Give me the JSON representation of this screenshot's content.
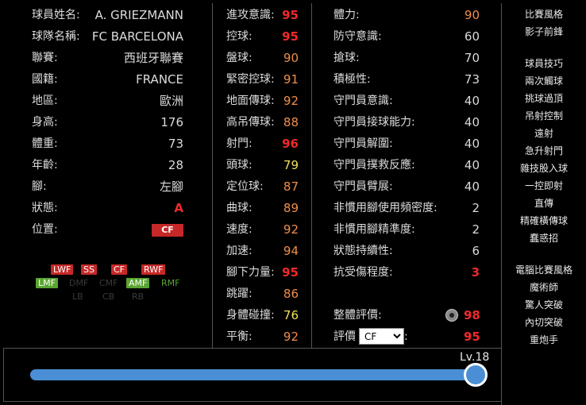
{
  "colors": {
    "red": "#ef2a2a",
    "orange": "#f08e4a",
    "yellow": "#f0e05a",
    "white": "#d9d9d9",
    "tag_red": "#c62828",
    "tag_green": "#5aa532",
    "text_green": "#5aa532"
  },
  "player": {
    "rows": [
      {
        "label": "球員姓名:",
        "value": "A. GRIEZMANN"
      },
      {
        "label": "球隊名稱:",
        "value": "FC BARCELONA"
      },
      {
        "label": "聯賽:",
        "value": "西班牙聯賽"
      },
      {
        "label": "國籍:",
        "value": "FRANCE"
      },
      {
        "label": "地區:",
        "value": "歐洲"
      },
      {
        "label": "身高:",
        "value": "176"
      },
      {
        "label": "體重:",
        "value": "73"
      },
      {
        "label": "年齡:",
        "value": "28"
      },
      {
        "label": "腳:",
        "value": "左腳"
      },
      {
        "label": "狀態:",
        "value": "A"
      },
      {
        "label": "位置:",
        "value": "CF"
      }
    ],
    "positions_row1": [
      "LWF",
      "SS",
      "CF",
      "RWF"
    ],
    "positions_row2": [
      "LMF",
      "DMF",
      "CMF",
      "AMF",
      "RMF"
    ],
    "positions_row3": [
      "LB",
      "CB",
      "RB"
    ]
  },
  "stats_col1": [
    {
      "label": "進攻意識:",
      "value": "95",
      "color": "red"
    },
    {
      "label": "控球:",
      "value": "95",
      "color": "red"
    },
    {
      "label": "盤球:",
      "value": "90",
      "color": "orange"
    },
    {
      "label": "緊密控球:",
      "value": "91",
      "color": "orange"
    },
    {
      "label": "地面傳球:",
      "value": "92",
      "color": "orange"
    },
    {
      "label": "高吊傳球:",
      "value": "88",
      "color": "orange"
    },
    {
      "label": "射門:",
      "value": "96",
      "color": "red"
    },
    {
      "label": "頭球:",
      "value": "79",
      "color": "yellow"
    },
    {
      "label": "定位球:",
      "value": "87",
      "color": "orange"
    },
    {
      "label": "曲球:",
      "value": "89",
      "color": "orange"
    },
    {
      "label": "速度:",
      "value": "92",
      "color": "orange"
    },
    {
      "label": "加速:",
      "value": "94",
      "color": "orange"
    },
    {
      "label": "腳下力量:",
      "value": "95",
      "color": "red"
    },
    {
      "label": "跳躍:",
      "value": "86",
      "color": "orange"
    },
    {
      "label": "身體碰撞:",
      "value": "76",
      "color": "yellow"
    },
    {
      "label": "平衡:",
      "value": "92",
      "color": "orange"
    }
  ],
  "stats_col2": [
    {
      "label": "體力:",
      "value": "90",
      "color": "orange"
    },
    {
      "label": "防守意識:",
      "value": "60",
      "color": "white"
    },
    {
      "label": "搶球:",
      "value": "70",
      "color": "white"
    },
    {
      "label": "積極性:",
      "value": "73",
      "color": "white"
    },
    {
      "label": "守門員意識:",
      "value": "40",
      "color": "white"
    },
    {
      "label": "守門員接球能力:",
      "value": "40",
      "color": "white"
    },
    {
      "label": "守門員解圍:",
      "value": "40",
      "color": "white"
    },
    {
      "label": "守門員撲救反應:",
      "value": "40",
      "color": "white"
    },
    {
      "label": "守門員臂展:",
      "value": "40",
      "color": "white"
    },
    {
      "label": "非慣用腳使用頻密度:",
      "value": "2",
      "color": "white"
    },
    {
      "label": "非慣用腳精準度:",
      "value": "2",
      "color": "white"
    },
    {
      "label": "狀態持續性:",
      "value": "6",
      "color": "white"
    },
    {
      "label": "抗受傷程度:",
      "value": "3",
      "color": "red"
    }
  ],
  "overall": {
    "label": "整體評價:",
    "value": "98"
  },
  "rating": {
    "label": "評價",
    "selected": "CF",
    "value": "95"
  },
  "sidebar": {
    "style_title": "比賽風格",
    "style": "影子前鋒",
    "skills_title": "球員技巧",
    "skills": [
      "兩次觸球",
      "挑球過頂",
      "吊射控制",
      "遠射",
      "急升射門",
      "雜技股入球",
      "一控即射",
      "直傳",
      "精確橫傳球",
      "蠢惑招"
    ],
    "ai_title": "電腦比賽風格",
    "ai": [
      "魔術師",
      "驚人突破",
      "內切突破",
      "重炮手"
    ]
  },
  "level": {
    "label": "Lv.18",
    "progress": 1.0
  }
}
